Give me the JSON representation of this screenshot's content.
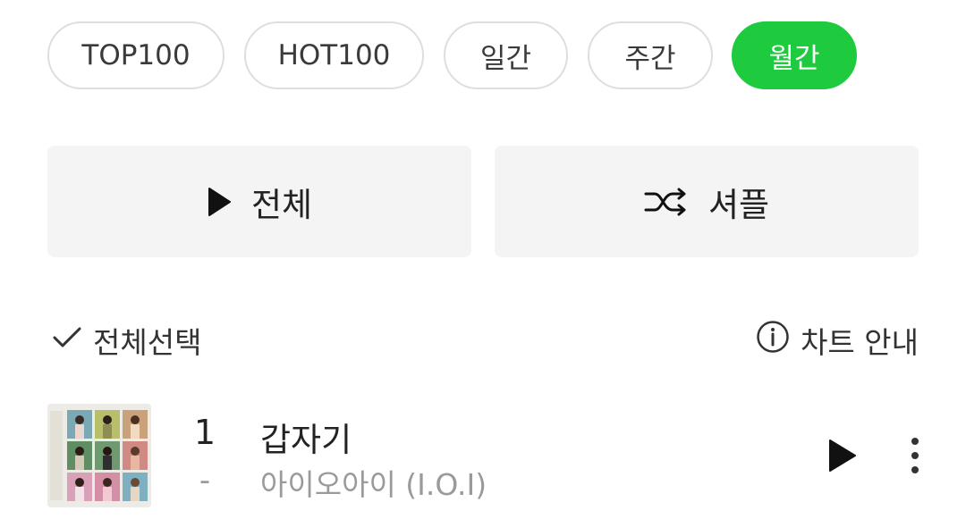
{
  "chips": [
    {
      "label": "TOP100",
      "active": false
    },
    {
      "label": "HOT100",
      "active": false
    },
    {
      "label": "일간",
      "active": false
    },
    {
      "label": "주간",
      "active": false
    },
    {
      "label": "월간",
      "active": true
    }
  ],
  "actions": {
    "play_all_label": "전체",
    "play_all_icon": "play-icon",
    "shuffle_label": "셔플",
    "shuffle_icon": "shuffle-icon"
  },
  "list_header": {
    "select_all_label": "전체선택",
    "select_all_icon": "check-icon",
    "chart_info_label": "차트 안내",
    "chart_info_icon": "info-icon"
  },
  "songs": [
    {
      "rank": "1",
      "rank_change": "-",
      "title": "갑자기",
      "artist": "아이오아이 (I.O.I)",
      "play_icon": "play-icon",
      "more_icon": "more-vertical-icon"
    }
  ],
  "colors": {
    "accent": "#1ecb3e",
    "chip_border": "#dedede",
    "button_bg": "#f4f4f4",
    "secondary_text": "#9a9a9a"
  }
}
